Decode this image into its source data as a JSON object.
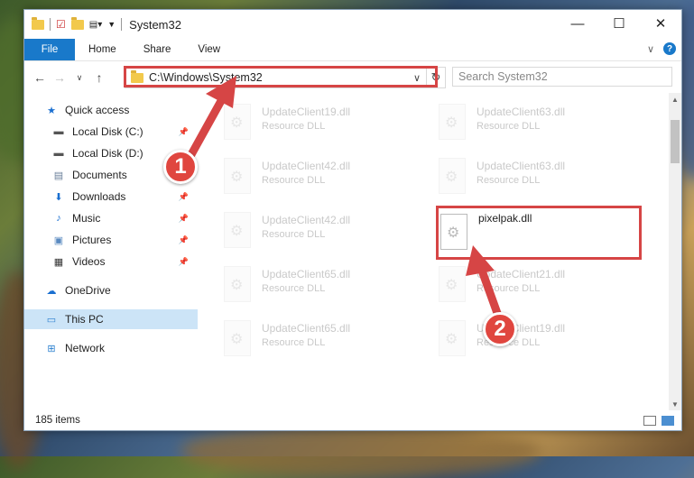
{
  "window": {
    "title": "System32",
    "controls": {
      "minimize": "—",
      "maximize": "☐",
      "close": "✕"
    }
  },
  "ribbon": {
    "tabs": [
      "File",
      "Home",
      "Share",
      "View"
    ]
  },
  "nav": {
    "address": "C:\\Windows\\System32",
    "search_placeholder": "Search System32"
  },
  "sidebar": {
    "items": [
      {
        "label": "Quick access",
        "icon": "star-icon",
        "pinned": false
      },
      {
        "label": "Local Disk (C:)",
        "icon": "drive-icon",
        "pinned": true
      },
      {
        "label": "Local Disk (D:)",
        "icon": "drive-icon",
        "pinned": false
      },
      {
        "label": "Documents",
        "icon": "documents-icon",
        "pinned": true
      },
      {
        "label": "Downloads",
        "icon": "download-icon",
        "pinned": true
      },
      {
        "label": "Music",
        "icon": "music-icon",
        "pinned": true
      },
      {
        "label": "Pictures",
        "icon": "pictures-icon",
        "pinned": true
      },
      {
        "label": "Videos",
        "icon": "videos-icon",
        "pinned": true
      },
      {
        "label": "OneDrive",
        "icon": "cloud-icon",
        "pinned": false
      },
      {
        "label": "This PC",
        "icon": "computer-icon",
        "pinned": false
      },
      {
        "label": "Network",
        "icon": "network-icon",
        "pinned": false
      }
    ]
  },
  "files": [
    {
      "name": "UpdateClient19.dll",
      "type": "Resource DLL"
    },
    {
      "name": "UpdateClient63.dll",
      "type": "Resource DLL"
    },
    {
      "name": "UpdateClient42.dll",
      "type": "Resource DLL"
    },
    {
      "name": "UpdateClient63.dll",
      "type": "Resource DLL"
    },
    {
      "name": "UpdateClient42.dll",
      "type": "Resource DLL"
    },
    {
      "name": "pixelpak.dll",
      "type": ""
    },
    {
      "name": "UpdateClient65.dll",
      "type": "Resource DLL"
    },
    {
      "name": "UpdateClient21.dll",
      "type": "Resource DLL"
    },
    {
      "name": "UpdateClient65.dll",
      "type": "Resource DLL"
    },
    {
      "name": "UpdateClient19.dll",
      "type": "Resource DLL"
    }
  ],
  "status": {
    "item_count": "185 items"
  },
  "callouts": {
    "one": "1",
    "two": "2"
  },
  "colors": {
    "accent": "#1979ca",
    "highlight": "#d64545",
    "selected": "#cce4f7"
  }
}
